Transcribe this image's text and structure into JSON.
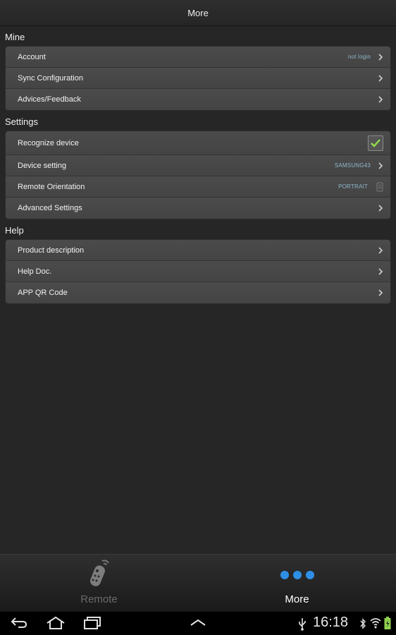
{
  "header": {
    "title": "More"
  },
  "sections": [
    {
      "title": "Mine",
      "rows": [
        {
          "label": "Account",
          "value": "not login",
          "control": "chevron"
        },
        {
          "label": "Sync Configuration",
          "value": "",
          "control": "chevron"
        },
        {
          "label": "Advices/Feedback",
          "value": "",
          "control": "chevron"
        }
      ]
    },
    {
      "title": "Settings",
      "rows": [
        {
          "label": "Recognize device",
          "value": "",
          "control": "checkbox",
          "checked": true
        },
        {
          "label": "Device setting",
          "value": "SAMSUNG43",
          "control": "chevron"
        },
        {
          "label": "Remote Orientation",
          "value": "PORTRAIT",
          "control": "phone-icon"
        },
        {
          "label": "Advanced Settings",
          "value": "",
          "control": "chevron"
        }
      ]
    },
    {
      "title": "Help",
      "rows": [
        {
          "label": "Product description",
          "value": "",
          "control": "chevron"
        },
        {
          "label": "Help Doc.",
          "value": "",
          "control": "chevron"
        },
        {
          "label": "APP QR Code",
          "value": "",
          "control": "chevron"
        }
      ]
    }
  ],
  "tabs": {
    "remote": {
      "label": "Remote",
      "icon": "remote-control-icon"
    },
    "more": {
      "label": "More",
      "icon": "three-dots-icon"
    }
  },
  "status_bar": {
    "time": "16:18"
  },
  "colors": {
    "accent": "#2f8fe6",
    "value_text": "#8fb7c9"
  }
}
